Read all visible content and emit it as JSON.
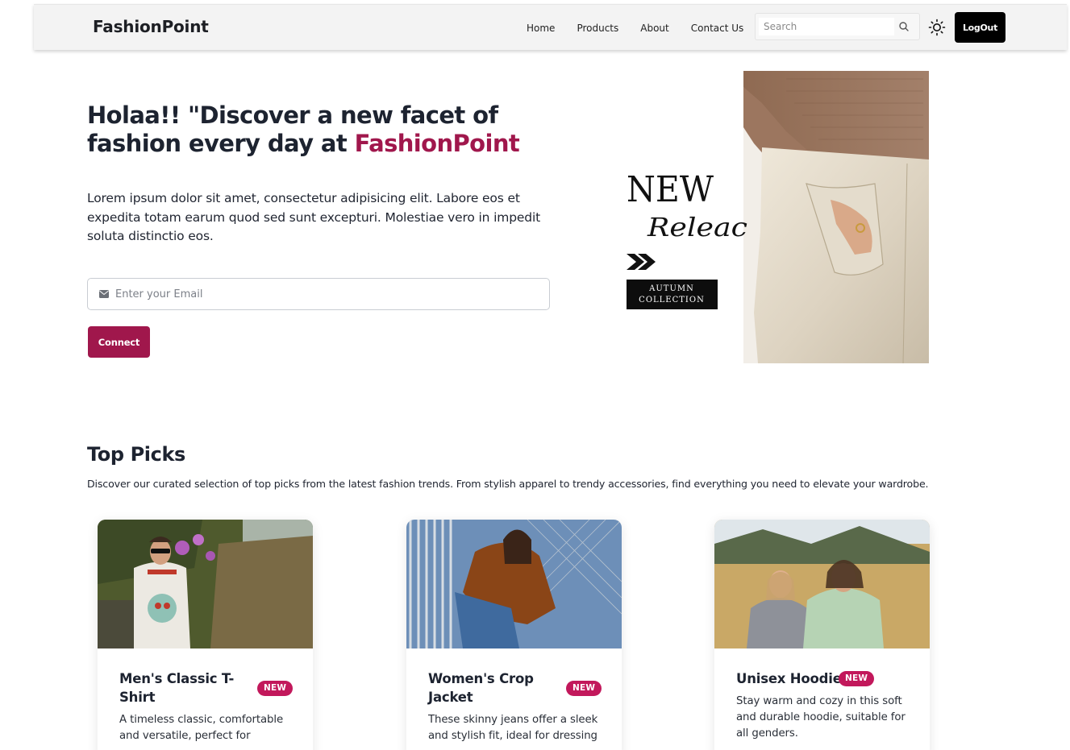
{
  "navbar": {
    "brand": "FashionPoint",
    "links": [
      "Home",
      "Products",
      "About",
      "Contact Us"
    ],
    "search_placeholder": "Search",
    "logout_label": "LogOut"
  },
  "hero": {
    "title_part1": "Holaa!! \"Discover a new facet of fashion every day at ",
    "title_accent": "FashionPoint",
    "description": "Lorem ipsum dolor sit amet, consectetur adipisicing elit. Labore eos et expedita totam earum quod sed sunt excepturi. Molestiae vero in impedit soluta distinctio eos.",
    "email_placeholder": "Enter your Email",
    "connect_label": "Connect",
    "image_text": {
      "new": "NEW",
      "release": "Releac",
      "collection_line1": "AUTUMN",
      "collection_line2": "COLLECTION"
    }
  },
  "top_picks": {
    "title": "Top Picks",
    "description": "Discover our curated selection of top picks from the latest fashion trends. From stylish apparel to trendy accessories, find everything you need to elevate your wardrobe.",
    "cards": [
      {
        "title": "Men's Classic T-Shirt",
        "badge": "NEW",
        "description": "A timeless classic, comfortable and versatile, perfect for"
      },
      {
        "title": "Women's Crop Jacket",
        "badge": "NEW",
        "description": "These skinny jeans offer a sleek and stylish fit, ideal for dressing"
      },
      {
        "title": "Unisex Hoodie",
        "badge": "NEW",
        "description": "Stay warm and cozy in this soft and durable hoodie, suitable for all genders."
      }
    ]
  },
  "colors": {
    "accent": "#a0174c",
    "badge": "#c2185b",
    "logout_bg": "#000000"
  }
}
